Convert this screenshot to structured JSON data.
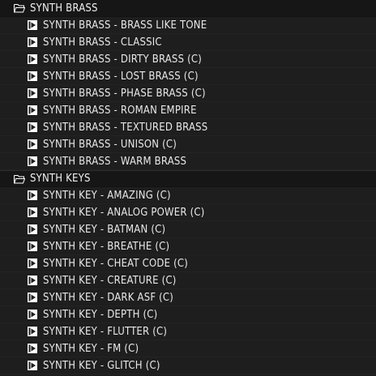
{
  "folders": [
    {
      "label": "SYNTH BRASS",
      "icon": "folder-open-icon",
      "items": [
        "SYNTH BRASS - BRASS LIKE TONE",
        "SYNTH BRASS - CLASSIC",
        "SYNTH BRASS - DIRTY BRASS (C)",
        "SYNTH BRASS - LOST BRASS (C)",
        "SYNTH BRASS - PHASE BRASS (C)",
        "SYNTH BRASS - ROMAN EMPIRE",
        "SYNTH BRASS - TEXTURED BRASS",
        "SYNTH BRASS - UNISON (C)",
        "SYNTH BRASS - WARM BRASS"
      ]
    },
    {
      "label": "SYNTH KEYS",
      "icon": "folder-open-icon",
      "items": [
        "SYNTH KEY - AMAZING (C)",
        "SYNTH KEY - ANALOG POWER (C)",
        "SYNTH KEY - BATMAN (C)",
        "SYNTH KEY - BREATHE (C)",
        "SYNTH KEY - CHEAT CODE (C)",
        "SYNTH KEY - CREATURE (C)",
        "SYNTH KEY - DARK ASF (C)",
        "SYNTH KEY - DEPTH (C)",
        "SYNTH KEY - FLUTTER (C)",
        "SYNTH KEY - FM (C)",
        "SYNTH KEY - GLITCH (C)"
      ]
    }
  ],
  "item_icon": "preset-file-icon",
  "colors": {
    "background": "#1e1e1e",
    "folder_background": "#161616",
    "text": "#e8e8e8",
    "icon": "#ffffff"
  }
}
